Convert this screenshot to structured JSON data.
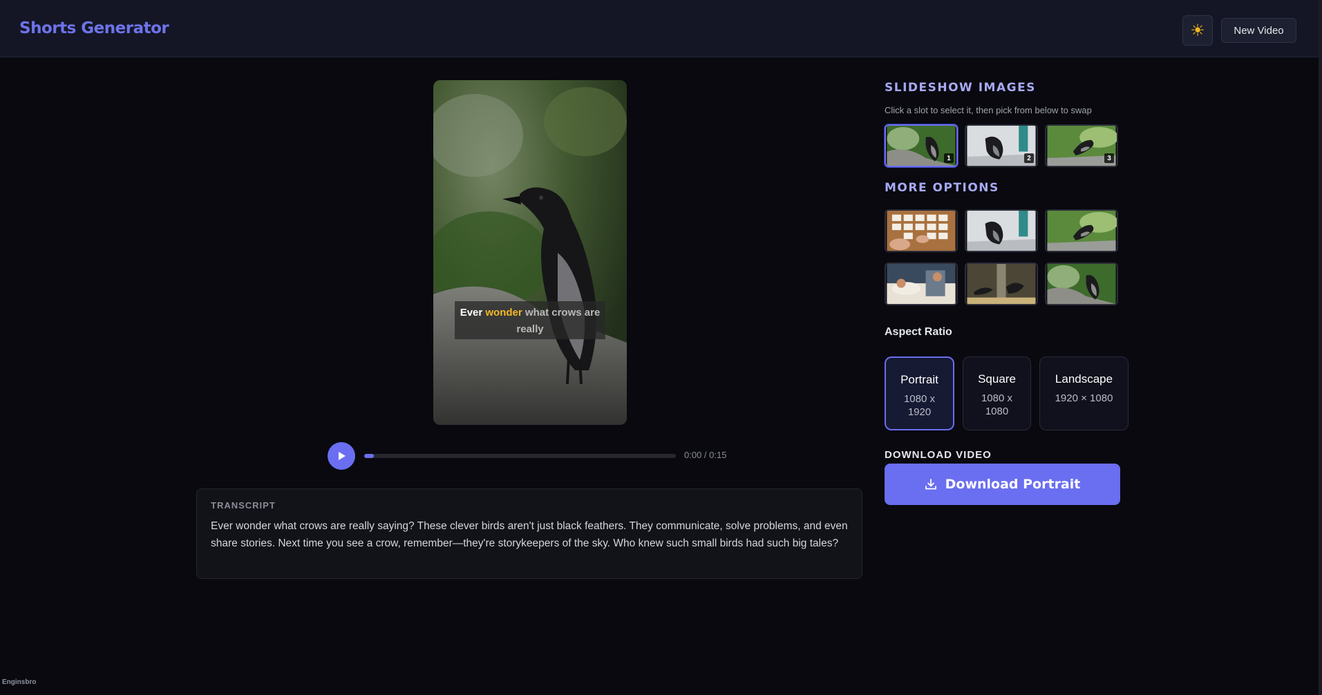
{
  "header": {
    "brand": "Shorts Generator",
    "theme_icon": "sun-icon",
    "new_video_label": "New Video"
  },
  "player": {
    "caption_words_spoken": "Ever",
    "caption_word_current": "wonder",
    "caption_words_upcoming": "what crows are really",
    "time_label": "0:00 / 0:15",
    "progress": 0.03
  },
  "transcript": {
    "title": "TRANSCRIPT",
    "text": "Ever wonder what crows are really saying? These clever birds aren't just black feathers. They communicate, solve problems, and even share stories. Next time you see a crow, remember—they're storykeepers of the sky. Who knew such small birds had such big tales?"
  },
  "slideshow": {
    "title": "SLIDESHOW IMAGES",
    "hint": "Click a slot to select it, then pick from below to swap",
    "slots": [
      "1",
      "2",
      "3"
    ]
  },
  "more_options": {
    "title": "MORE OPTIONS"
  },
  "aspect": {
    "label": "Aspect Ratio",
    "options": [
      {
        "name": "Portrait",
        "dims": "1080 x 1920"
      },
      {
        "name": "Square",
        "dims": "1080 x 1080"
      },
      {
        "name": "Landscape",
        "dims": "1920 × 1080"
      }
    ]
  },
  "download": {
    "section_label": "DOWNLOAD VIDEO",
    "button_label": "Download Portrait"
  },
  "footer": {
    "brand": "Enginsbro"
  },
  "colors": {
    "accent": "#6a6ef0",
    "background": "#09090f",
    "highlight_word": "#f2b928"
  }
}
